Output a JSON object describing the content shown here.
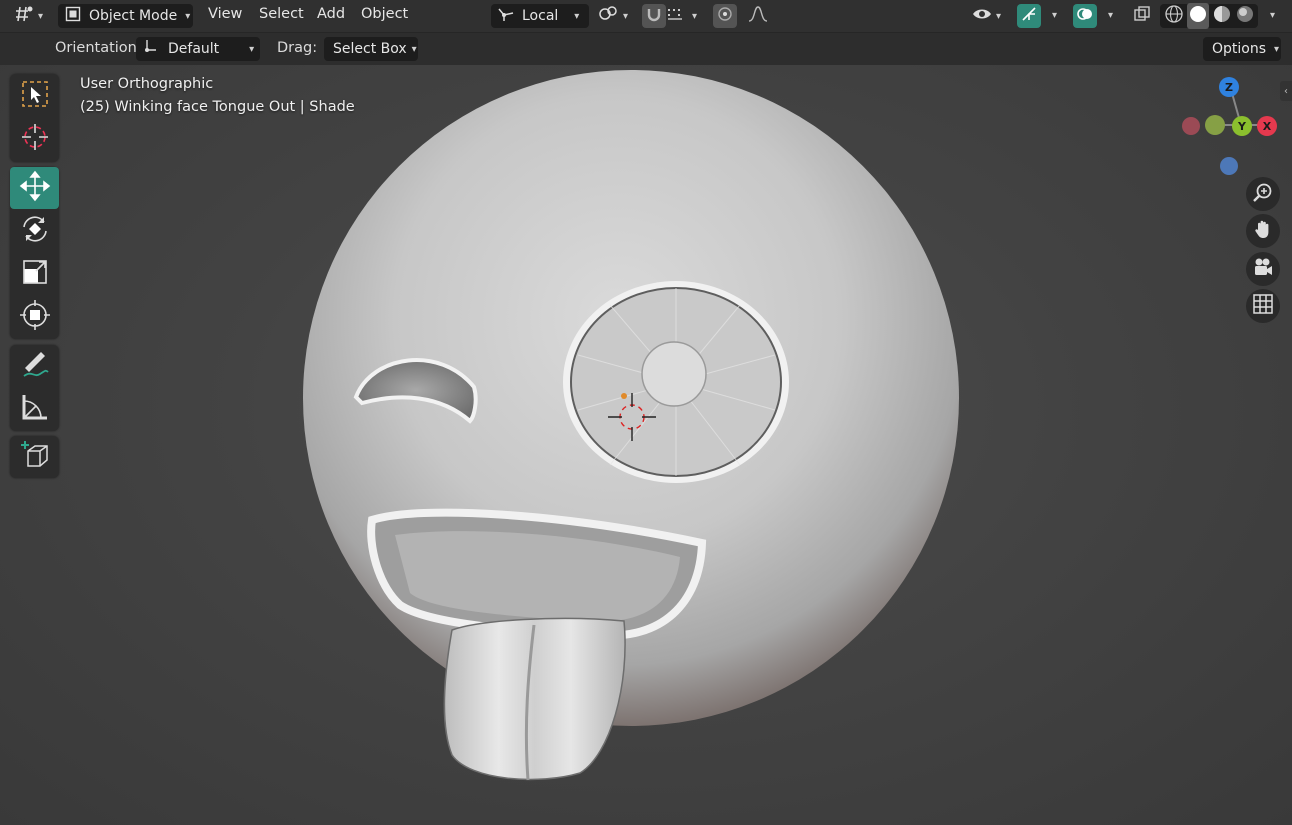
{
  "header": {
    "mode_label": "Object Mode",
    "menus": [
      "View",
      "Select",
      "Add",
      "Object"
    ],
    "transform_pivot_label": "Local",
    "options_label": "Options"
  },
  "tool_settings": {
    "orientation_label": "Orientation:",
    "orientation_value": "Default",
    "drag_label": "Drag:",
    "drag_value": "Select Box"
  },
  "viewport": {
    "view_name": "User Orthographic",
    "object_info": "(25) Winking face Tongue Out | Shade"
  },
  "gizmo": {
    "axes": [
      "Z",
      "Y",
      "X"
    ]
  },
  "toolbar": {
    "tools": [
      "select-box",
      "cursor",
      "move",
      "rotate",
      "scale",
      "transform",
      "annotate",
      "measure",
      "add-cube"
    ],
    "active_tool": "move"
  },
  "colors": {
    "accent": "#2f8a7a",
    "axis_x": "#e5394e",
    "axis_y": "#8bbf2e",
    "axis_z": "#2f82e0"
  }
}
